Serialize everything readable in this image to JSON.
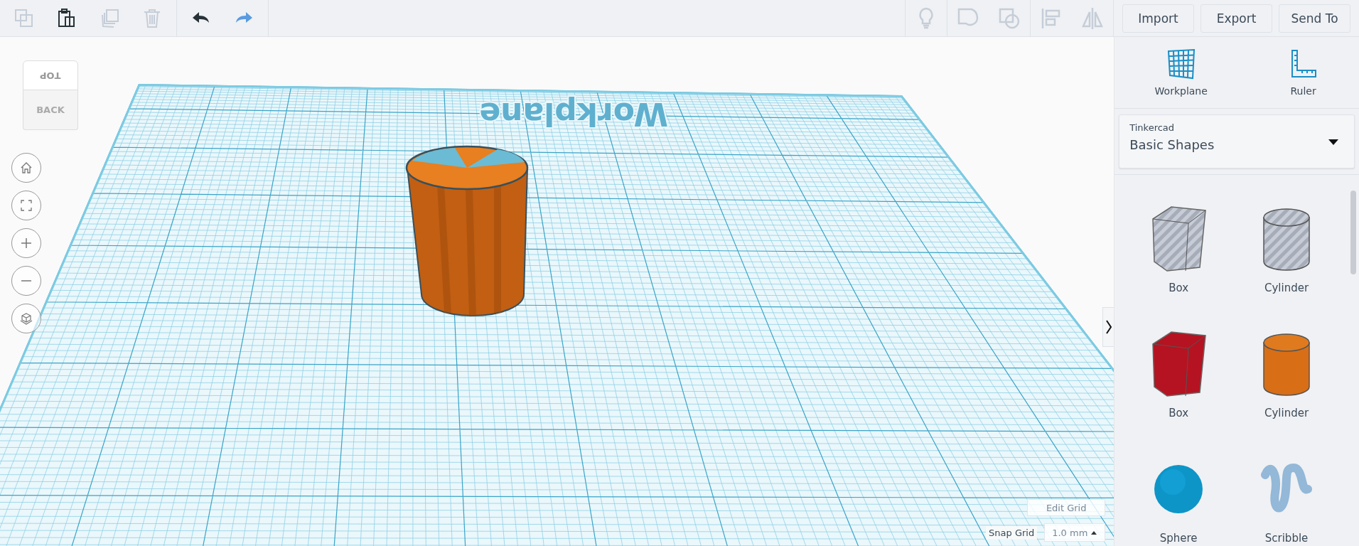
{
  "toolbar": {
    "edit_tools": [
      {
        "kind": "copy",
        "disabled": true
      },
      {
        "kind": "paste",
        "disabled": false
      },
      {
        "kind": "duplicate",
        "disabled": true
      },
      {
        "kind": "delete",
        "disabled": true
      }
    ],
    "history_tools": [
      {
        "kind": "undo",
        "disabled": false
      },
      {
        "kind": "redo",
        "disabled": false
      }
    ],
    "shape_tools": [
      {
        "kind": "note",
        "disabled": true
      },
      {
        "kind": "group",
        "disabled": true
      },
      {
        "kind": "ungroup",
        "disabled": true
      },
      {
        "kind": "align",
        "disabled": true
      },
      {
        "kind": "mirror",
        "disabled": true
      }
    ],
    "buttons": [
      "Import",
      "Export",
      "Send To"
    ]
  },
  "view_cube": {
    "top": "TOP",
    "front": "BACK"
  },
  "workplane": {
    "label": "Workplane"
  },
  "edit_grid": "Edit Grid",
  "snap_grid": {
    "label": "Snap Grid",
    "value": "1.0 mm"
  },
  "panel": {
    "tools": [
      {
        "kind": "workplane",
        "label": "Workplane"
      },
      {
        "kind": "ruler",
        "label": "Ruler"
      }
    ],
    "library": {
      "caption": "Tinkercad",
      "value": "Basic Shapes"
    },
    "shapes": [
      {
        "kind": "box-hole",
        "label": "Box"
      },
      {
        "kind": "cylinder-hole",
        "label": "Cylinder"
      },
      {
        "kind": "box",
        "label": "Box"
      },
      {
        "kind": "cylinder",
        "label": "Cylinder"
      },
      {
        "kind": "sphere",
        "label": "Sphere"
      },
      {
        "kind": "scribble",
        "label": "Scribble"
      }
    ]
  }
}
